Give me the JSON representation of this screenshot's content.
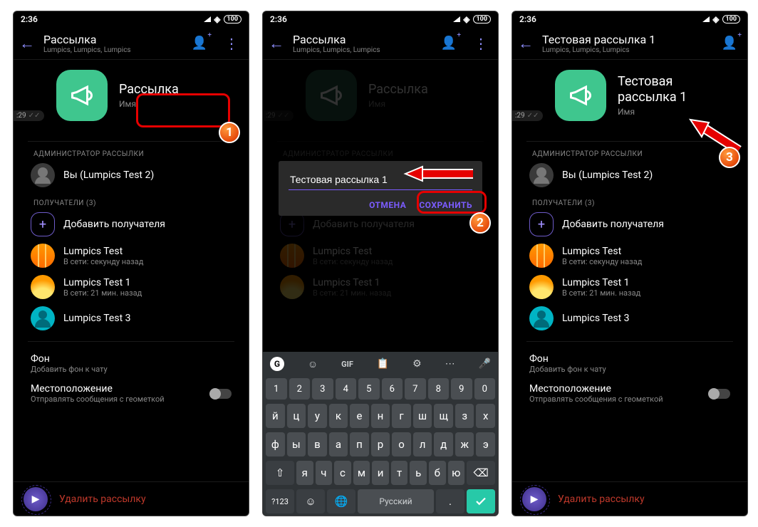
{
  "status": {
    "time": "2:36",
    "batt": "100"
  },
  "s1": {
    "title": "Рассылка",
    "subtitle": "Lumpics, Lumpics, Lumpics",
    "hero_name": "Рассылка",
    "hero_lbl": "Имя",
    "time_badge": ":29"
  },
  "s2": {
    "title": "Рассылка",
    "subtitle": "Lumpics, Lumpics, Lumpics",
    "hero_name": "Рассылка",
    "hero_lbl": "Имя",
    "time_badge": ":29",
    "dialog_value": "Тестовая рассылка 1",
    "cancel": "ОТМЕНА",
    "save": "СОХРАНИТЬ",
    "kb_lang": "Русский"
  },
  "s3": {
    "title": "Тестовая рассылка 1",
    "subtitle": "Lumpics, Lumpics, Lumpics",
    "hero_name": "Тестовая\nрассылка 1",
    "hero_lbl": "Имя",
    "time_badge": ":29"
  },
  "labels": {
    "admin": "АДМИНИСТРАТОР РАССЫЛКИ",
    "admin_name": "Вы (Lumpics Test 2)",
    "recipients": "ПОЛУЧАТЕЛИ (3)",
    "add_recipient": "Добавить получателя",
    "bg": "Фон",
    "bg_sub": "Добавить фон к чату",
    "loc": "Местоположение",
    "loc_sub": "Отправлять сообщения с геометкой",
    "delete": "Удалить рассылку"
  },
  "recipients": [
    {
      "name": "Lumpics Test",
      "status": "В сети: секунду назад"
    },
    {
      "name": "Lumpics Test 1",
      "status": "В сети: 21 мин. назад"
    },
    {
      "name": "Lumpics Test 3",
      "status": ""
    }
  ],
  "kb": {
    "nums": [
      "1",
      "2",
      "3",
      "4",
      "5",
      "6",
      "7",
      "8",
      "9",
      "0"
    ],
    "row1": [
      "й",
      "ц",
      "у",
      "к",
      "е",
      "н",
      "г",
      "ш",
      "щ",
      "з",
      "х"
    ],
    "row2": [
      "ф",
      "ы",
      "в",
      "а",
      "п",
      "р",
      "о",
      "л",
      "д",
      "ж",
      "э"
    ],
    "row3": [
      "я",
      "ч",
      "с",
      "м",
      "и",
      "т",
      "ь",
      "б",
      "ю"
    ],
    "gif": "GIF",
    "sym": "?123"
  },
  "callouts": {
    "c1": "1",
    "c2": "2",
    "c3": "3"
  }
}
